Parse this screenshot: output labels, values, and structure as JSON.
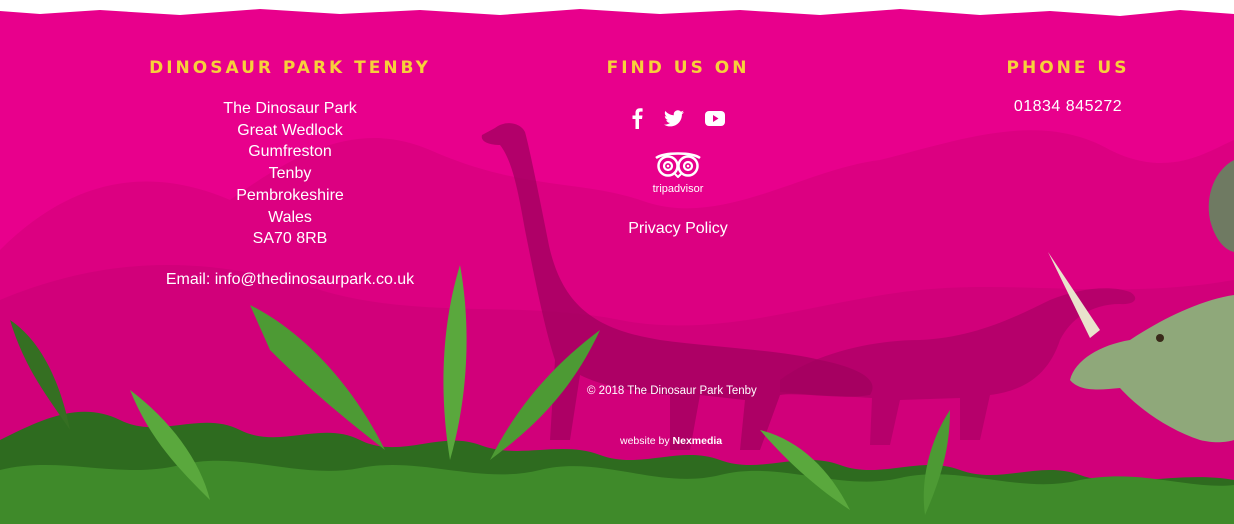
{
  "colors": {
    "background": "#e8008c",
    "heading": "#f7d03b",
    "text": "#ffffff"
  },
  "address_column": {
    "heading": "DINOSAUR PARK TENBY",
    "lines": [
      "The Dinosaur Park",
      "Great Wedlock",
      "Gumfreston",
      "Tenby",
      "Pembrokeshire",
      "Wales",
      "SA70 8RB"
    ],
    "email": "Email: info@thedinosaurpark.co.uk"
  },
  "social_column": {
    "heading": "FIND US ON",
    "icons": [
      "facebook-icon",
      "twitter-icon",
      "youtube-icon",
      "tripadvisor-logo-icon"
    ],
    "tripadvisor_label": "tripadvisor",
    "privacy_link": "Privacy Policy"
  },
  "phone_column": {
    "heading": "PHONE US",
    "number": "01834 845272"
  },
  "bottom": {
    "copyright": "© 2018 The Dinosaur Park Tenby",
    "credit_prefix": "website by ",
    "credit_brand": "Nexmedia"
  }
}
